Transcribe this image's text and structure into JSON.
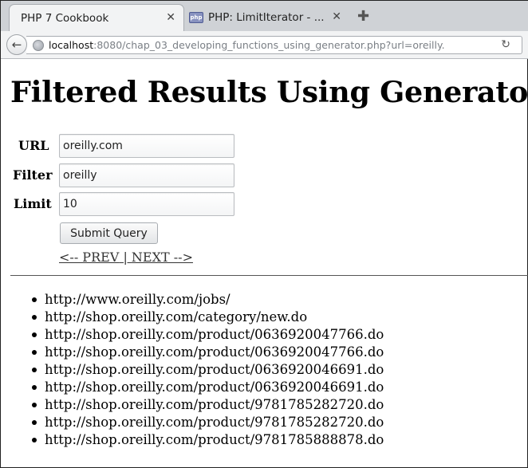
{
  "browser": {
    "tabs": [
      {
        "title": "PHP 7 Cookbook",
        "active": true
      },
      {
        "title": "PHP: LimitIterator - ...",
        "active": false,
        "favicon": "php"
      }
    ],
    "url_host": "localhost",
    "url_rest": ":8080/chap_03_developing_functions_using_generator.php?url=oreilly."
  },
  "page": {
    "title": "Filtered Results Using Generator",
    "form": {
      "url_label": "URL",
      "url_value": "oreilly.com",
      "filter_label": "Filter",
      "filter_value": "oreilly",
      "limit_label": "Limit",
      "limit_value": "10",
      "submit_label": "Submit Query"
    },
    "pager": {
      "prev": "<-- PREV",
      "separator": " | ",
      "next": "NEXT -->"
    },
    "results": [
      "http://www.oreilly.com/jobs/",
      "http://shop.oreilly.com/category/new.do",
      "http://shop.oreilly.com/product/0636920047766.do",
      "http://shop.oreilly.com/product/0636920047766.do",
      "http://shop.oreilly.com/product/0636920046691.do",
      "http://shop.oreilly.com/product/0636920046691.do",
      "http://shop.oreilly.com/product/9781785282720.do",
      "http://shop.oreilly.com/product/9781785282720.do",
      "http://shop.oreilly.com/product/9781785888878.do"
    ]
  }
}
